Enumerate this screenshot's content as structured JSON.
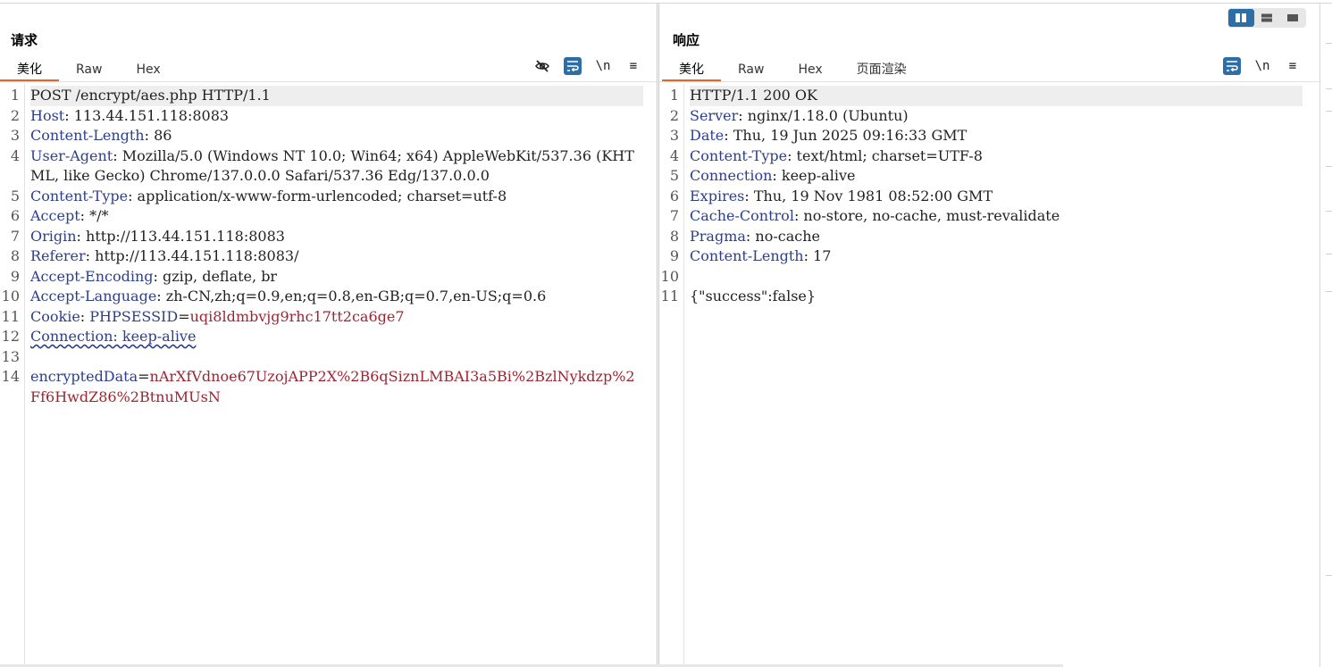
{
  "request": {
    "title": "请求",
    "tabs": [
      {
        "label": "美化",
        "active": true
      },
      {
        "label": "Raw",
        "active": false
      },
      {
        "label": "Hex",
        "active": false
      }
    ],
    "tools": [
      {
        "name": "hide-icon",
        "glyph": "",
        "active": false
      },
      {
        "name": "wrap-icon",
        "glyph": "",
        "active": true
      },
      {
        "name": "newline-toggle",
        "glyph": "\\n",
        "active": false
      },
      {
        "name": "menu-icon",
        "glyph": "≡",
        "active": false
      }
    ],
    "lines": [
      {
        "n": "1",
        "parts": [
          {
            "t": "POST /encrypt/aes.php HTTP/1.1",
            "c": "hv"
          }
        ]
      },
      {
        "n": "2",
        "parts": [
          {
            "t": "Host",
            "c": "hk"
          },
          {
            "t": ": 113.44.151.118:8083",
            "c": "hv"
          }
        ]
      },
      {
        "n": "3",
        "parts": [
          {
            "t": "Content-Length",
            "c": "hk"
          },
          {
            "t": ": 86",
            "c": "hv"
          }
        ]
      },
      {
        "n": "4",
        "parts": [
          {
            "t": "User-Agent",
            "c": "hk"
          },
          {
            "t": ": Mozilla/5.0 (Windows NT 10.0; Win64; x64) AppleWebKit/537.36 (KHTML, like Gecko) Chrome/137.0.0.0 Safari/537.36 Edg/137.0.0.0",
            "c": "hv"
          }
        ]
      },
      {
        "n": "5",
        "parts": [
          {
            "t": "Content-Type",
            "c": "hk"
          },
          {
            "t": ": application/x-www-form-urlencoded; charset=utf-8",
            "c": "hv"
          }
        ]
      },
      {
        "n": "6",
        "parts": [
          {
            "t": "Accept",
            "c": "hk"
          },
          {
            "t": ": */*",
            "c": "hv"
          }
        ]
      },
      {
        "n": "7",
        "parts": [
          {
            "t": "Origin",
            "c": "hk"
          },
          {
            "t": ": http://113.44.151.118:8083",
            "c": "hv"
          }
        ]
      },
      {
        "n": "8",
        "parts": [
          {
            "t": "Referer",
            "c": "hk"
          },
          {
            "t": ": http://113.44.151.118:8083/",
            "c": "hv"
          }
        ]
      },
      {
        "n": "9",
        "parts": [
          {
            "t": "Accept-Encoding",
            "c": "hk"
          },
          {
            "t": ": gzip, deflate, br",
            "c": "hv"
          }
        ]
      },
      {
        "n": "10",
        "parts": [
          {
            "t": "Accept-Language",
            "c": "hk"
          },
          {
            "t": ": zh-CN,zh;q=0.9,en;q=0.8,en-GB;q=0.7,en-US;q=0.6",
            "c": "hv"
          }
        ]
      },
      {
        "n": "11",
        "parts": [
          {
            "t": "Cookie",
            "c": "hk"
          },
          {
            "t": ": ",
            "c": "hv"
          },
          {
            "t": "PHPSESSID",
            "c": "pk"
          },
          {
            "t": "=",
            "c": "hv"
          },
          {
            "t": "uqi8ldmbvjg9rhc17tt2ca6ge7",
            "c": "ck"
          }
        ]
      },
      {
        "n": "12",
        "parts": [
          {
            "t": "Connection: keep-alive",
            "c": "hk wavy"
          }
        ]
      },
      {
        "n": "13",
        "parts": [
          {
            "t": "",
            "c": "hv"
          }
        ]
      },
      {
        "n": "14",
        "parts": [
          {
            "t": "encryptedData",
            "c": "pk"
          },
          {
            "t": "=",
            "c": "hv"
          },
          {
            "t": "nArXfVdnoe67UzojAPP2X%2B6qSiznLMBAI3a5Bi%2BzlNykdzp%2Ff6HwdZ86%2BtnuMUsN",
            "c": "pv"
          }
        ]
      }
    ]
  },
  "response": {
    "title": "响应",
    "tabs": [
      {
        "label": "美化",
        "active": true
      },
      {
        "label": "Raw",
        "active": false
      },
      {
        "label": "Hex",
        "active": false
      },
      {
        "label": "页面渲染",
        "active": false
      }
    ],
    "tools": [
      {
        "name": "wrap-icon",
        "glyph": "",
        "active": true
      },
      {
        "name": "newline-toggle",
        "glyph": "\\n",
        "active": false
      },
      {
        "name": "menu-icon",
        "glyph": "≡",
        "active": false
      }
    ],
    "lines": [
      {
        "n": "1",
        "parts": [
          {
            "t": "HTTP/1.1 200 OK",
            "c": "hv"
          }
        ]
      },
      {
        "n": "2",
        "parts": [
          {
            "t": "Server",
            "c": "hk"
          },
          {
            "t": ": nginx/1.18.0 (Ubuntu)",
            "c": "hv"
          }
        ]
      },
      {
        "n": "3",
        "parts": [
          {
            "t": "Date",
            "c": "hk"
          },
          {
            "t": ": Thu, 19 Jun 2025 09:16:33 GMT",
            "c": "hv"
          }
        ]
      },
      {
        "n": "4",
        "parts": [
          {
            "t": "Content-Type",
            "c": "hk"
          },
          {
            "t": ": text/html; charset=UTF-8",
            "c": "hv"
          }
        ]
      },
      {
        "n": "5",
        "parts": [
          {
            "t": "Connection",
            "c": "hk"
          },
          {
            "t": ": keep-alive",
            "c": "hv"
          }
        ]
      },
      {
        "n": "6",
        "parts": [
          {
            "t": "Expires",
            "c": "hk"
          },
          {
            "t": ": Thu, 19 Nov 1981 08:52:00 GMT",
            "c": "hv"
          }
        ]
      },
      {
        "n": "7",
        "parts": [
          {
            "t": "Cache-Control",
            "c": "hk"
          },
          {
            "t": ": no-store, no-cache, must-revalidate",
            "c": "hv"
          }
        ]
      },
      {
        "n": "8",
        "parts": [
          {
            "t": "Pragma",
            "c": "hk"
          },
          {
            "t": ": no-cache",
            "c": "hv"
          }
        ]
      },
      {
        "n": "9",
        "parts": [
          {
            "t": "Content-Length",
            "c": "hk"
          },
          {
            "t": ": 17",
            "c": "hv"
          }
        ]
      },
      {
        "n": "10",
        "parts": [
          {
            "t": "",
            "c": "hv"
          }
        ]
      },
      {
        "n": "11",
        "parts": [
          {
            "t": "{\"success\":false}",
            "c": "hv"
          }
        ]
      }
    ]
  },
  "layout_buttons": [
    {
      "name": "layout-side-by-side-button",
      "active": true
    },
    {
      "name": "layout-stacked-button",
      "active": false
    },
    {
      "name": "layout-single-button",
      "active": false
    }
  ],
  "colors": {
    "accent_tab": "#e8632c",
    "tool_active": "#2e6ea6",
    "header_key": "#2c3f8f",
    "param_value": "#9c2430"
  }
}
